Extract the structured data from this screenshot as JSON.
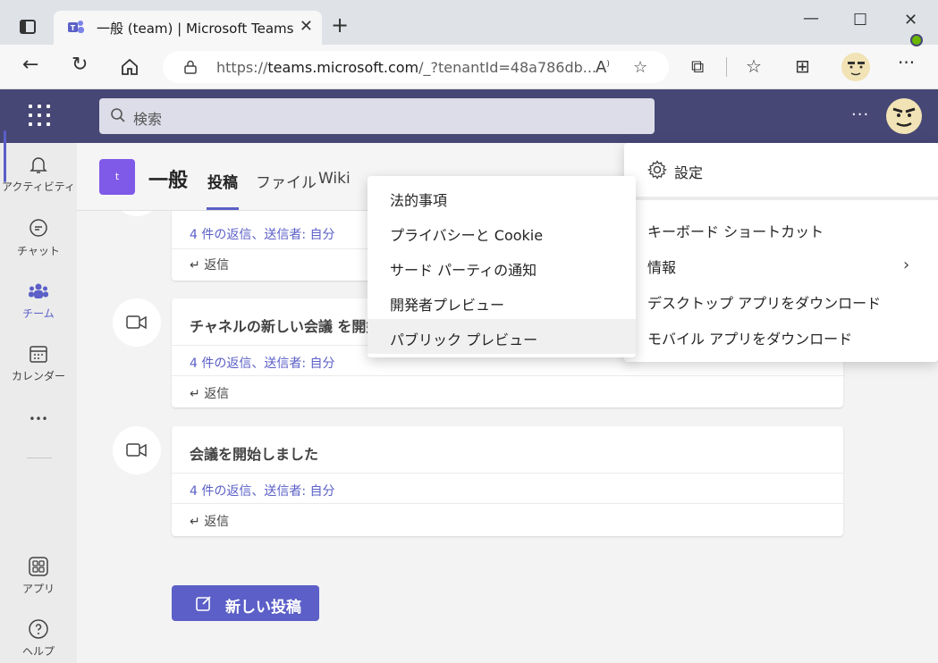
{
  "browser": {
    "tab_title": "一般 (team) | Microsoft Teams",
    "url_prefix": "https://",
    "url_host": "teams.microsoft.com",
    "url_rest": "/_?tenantId=48a786db..."
  },
  "app": {
    "search_placeholder": "検索",
    "accent": "#5b5fc7",
    "header_bg": "#464775"
  },
  "rail": {
    "activity": "アクティビティ",
    "chat": "チャット",
    "teams": "チーム",
    "calendar": "カレンダー",
    "more": "•••",
    "apps": "アプリ",
    "help": "ヘルプ"
  },
  "channel": {
    "team_initial": "t",
    "name": "一般",
    "tabs": [
      "投稿",
      "ファイル",
      "Wiki"
    ]
  },
  "posts": [
    {
      "title": "チャネルの新しい会議 を開始",
      "replies": "4 件の返信、送信者: 自分",
      "reply": "返信"
    },
    {
      "title": "会議を開始しました",
      "replies": "4 件の返信、送信者: 自分",
      "reply": "返信"
    }
  ],
  "top_post": {
    "replies": "4 件の返信、送信者: 自分",
    "reply": "返信"
  },
  "new_post_label": "新しい投稿",
  "settings_menu": {
    "settings": "設定",
    "keyboard": "キーボード ショートカット",
    "info": "情報",
    "desktop": "デスクトップ アプリをダウンロード",
    "mobile": "モバイル アプリをダウンロード"
  },
  "info_submenu": [
    "法的事項",
    "プライバシーと Cookie",
    "サード パーティの通知",
    "開発者プレビュー",
    "パブリック プレビュー"
  ]
}
